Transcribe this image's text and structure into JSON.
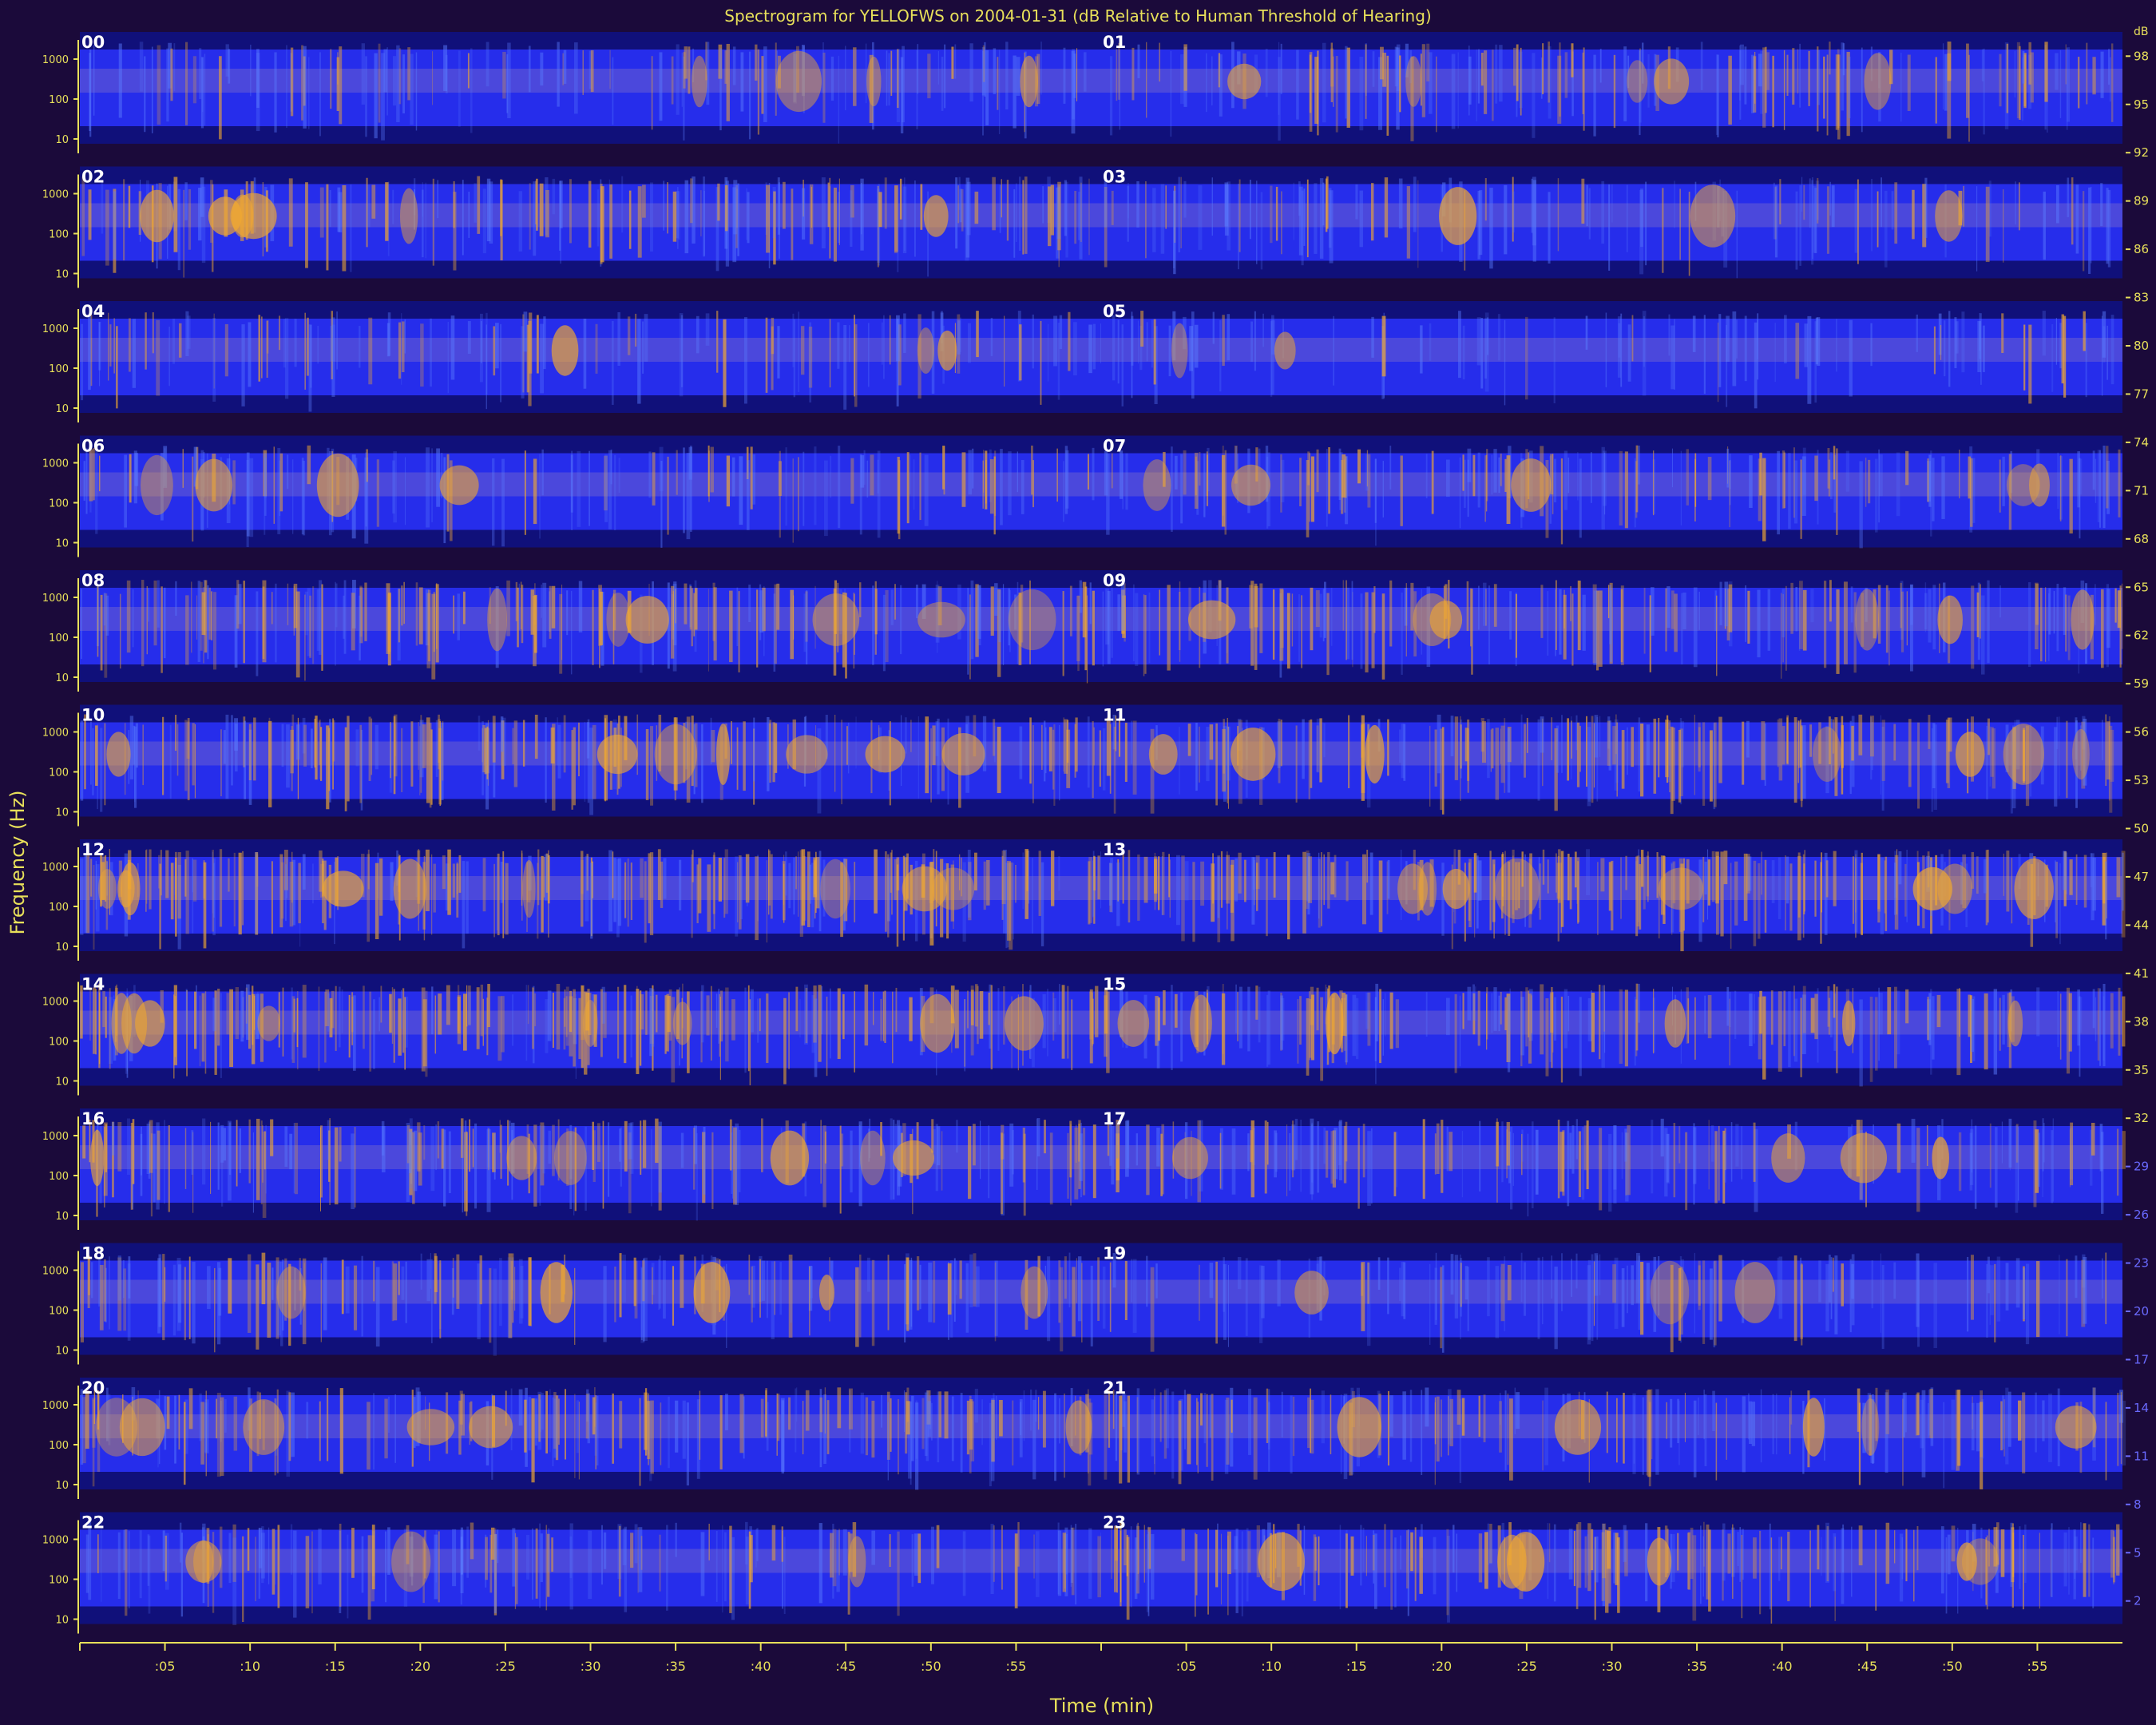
{
  "chart_data": {
    "type": "heatmap",
    "title": "Spectrogram for YELLOFWS on 2004-01-31 (dB Relative to Human Threshold of Hearing)",
    "xlabel": "Time (min)",
    "ylabel": "Frequency (Hz)",
    "hour_labels": [
      "00",
      "01",
      "02",
      "03",
      "04",
      "05",
      "06",
      "07",
      "08",
      "09",
      "10",
      "11",
      "12",
      "13",
      "14",
      "15",
      "16",
      "17",
      "18",
      "19",
      "20",
      "21",
      "22",
      "23"
    ],
    "y_ticks": [
      "1000",
      "100",
      "10"
    ],
    "x_ticks": [
      ":05",
      ":10",
      ":15",
      ":20",
      ":25",
      ":30",
      ":35",
      ":40",
      ":45",
      ":50",
      ":55"
    ],
    "x_range_min": [
      0,
      60
    ],
    "colorbar": {
      "unit": "dB",
      "ticks": [
        98,
        95,
        92,
        89,
        86,
        83,
        80,
        77,
        74,
        71,
        68,
        65,
        62,
        59,
        56,
        53,
        50,
        47,
        44,
        41,
        38,
        35,
        32,
        29,
        26,
        23,
        20,
        17,
        14,
        11,
        8,
        5,
        2
      ],
      "range": [
        0,
        100
      ]
    },
    "activity_per_hour": [
      0.35,
      0.45,
      0.5,
      0.3,
      0.3,
      0.2,
      0.35,
      0.45,
      0.55,
      0.5,
      0.6,
      0.6,
      0.75,
      0.7,
      0.7,
      0.55,
      0.55,
      0.4,
      0.45,
      0.3,
      0.55,
      0.45,
      0.4,
      0.55
    ],
    "colors": {
      "background": "#1b0a3a",
      "quiet": "#10107a",
      "band": "#2a33ff",
      "loud": "#f0a830",
      "text": "#e8e05a",
      "hour_label": "#ffffff"
    }
  }
}
